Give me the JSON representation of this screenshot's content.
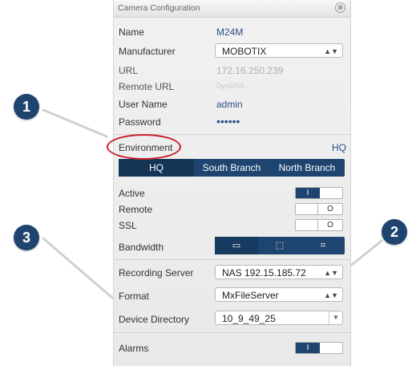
{
  "window": {
    "title": "Camera Configuration"
  },
  "fields": {
    "name_label": "Name",
    "name_value": "M24M",
    "manufacturer_label": "Manufacturer",
    "manufacturer_value": "MOBOTIX",
    "url_label": "URL",
    "url_value": "172.16.250.239",
    "remote_url_label": "Remote URL",
    "remote_url_value": "DynDNS",
    "user_label": "User Name",
    "user_value": "admin",
    "password_label": "Password",
    "password_value": "••••••"
  },
  "environment": {
    "label": "Environment",
    "value": "HQ",
    "tabs": [
      "HQ",
      "South Branch",
      "North Branch"
    ],
    "selected": "HQ"
  },
  "toggles": {
    "active_label": "Active",
    "active_state": "I",
    "remote_label": "Remote",
    "remote_state": "O",
    "ssl_label": "SSL",
    "ssl_state": "O"
  },
  "bandwidth": {
    "label": "Bandwidth",
    "options": [
      "▭",
      "⬚",
      "⌗"
    ]
  },
  "recording_server": {
    "label": "Recording Server",
    "value": "NAS 192.15.185.72"
  },
  "format": {
    "label": "Format",
    "value": "MxFileServer"
  },
  "device_directory": {
    "label": "Device Directory",
    "value": "10_9_49_25"
  },
  "alarms": {
    "label": "Alarms",
    "state": "I"
  },
  "callouts": [
    "1",
    "2",
    "3"
  ],
  "colors": {
    "accent": "#1e4470",
    "highlight": "#c8202a"
  }
}
